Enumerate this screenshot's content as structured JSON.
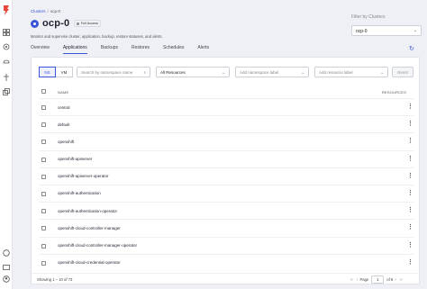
{
  "breadcrumb": {
    "root": "Clusters",
    "current": "ocp-0"
  },
  "cluster": {
    "name": "ocp-0",
    "badge": "Full Access",
    "description": "Monitor and supervise cluster, application, backup, restore statuses, and alerts."
  },
  "filter": {
    "label": "Filter by Clusters",
    "value": "ocp-0"
  },
  "tabs": [
    "Overview",
    "Applications",
    "Backups",
    "Restores",
    "Schedules",
    "Alerts"
  ],
  "active_tab": "Applications",
  "toolbar": {
    "ns_label": "NS",
    "vm_label": "VM",
    "search_placeholder": "Search by namespace name",
    "resources_value": "All Resources",
    "ns_label_placeholder": "Add namespace label",
    "resource_label_placeholder": "Add resource label",
    "reset_label": "Reset"
  },
  "table": {
    "col_name": "NAME",
    "col_resources": "RESOURCES",
    "rows": [
      "central",
      "default",
      "openshift",
      "openshift-apiserver",
      "openshift-apiserver-operator",
      "openshift-authentication",
      "openshift-authentication-operator",
      "openshift-cloud-controller-manager",
      "openshift-cloud-controller-manager-operator",
      "openshift-cloud-credential-operator"
    ]
  },
  "pagination": {
    "showing": "Showing 1 – 10 of 73",
    "page_label": "Page",
    "page_value": "1",
    "of_label": "of 8"
  },
  "colors": {
    "accent": "#3b55d9",
    "logo": "#e8463a"
  }
}
